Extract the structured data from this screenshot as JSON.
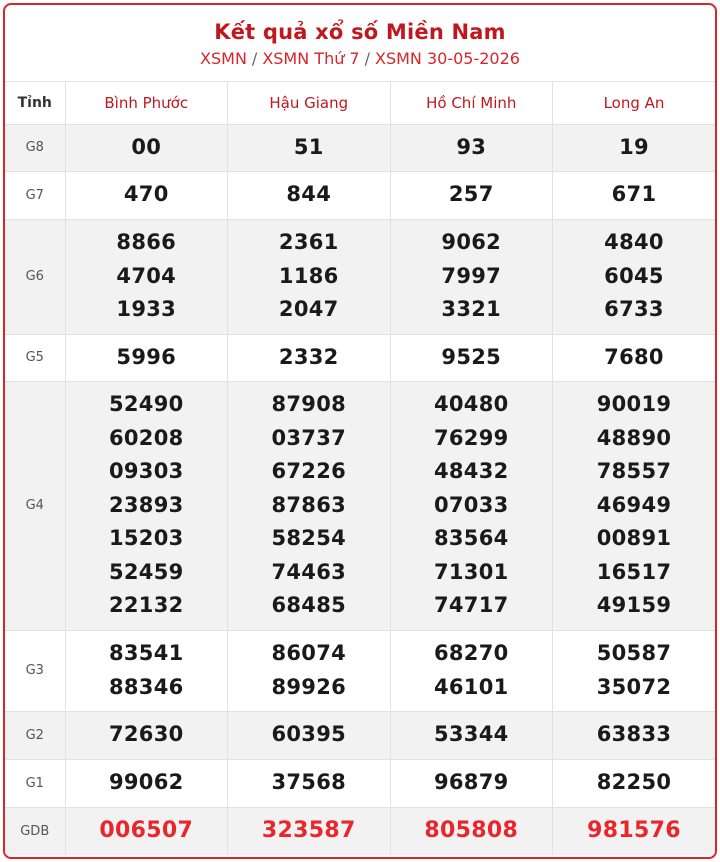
{
  "header": {
    "title": "Kết quả xổ số Miền Nam",
    "breadcrumb": [
      "XSMN",
      "XSMN Thứ 7",
      "XSMN 30-05-2026"
    ]
  },
  "table": {
    "corner_label": "Tỉnh",
    "provinces": [
      "Bình Phước",
      "Hậu Giang",
      "Hồ Chí Minh",
      "Long An"
    ],
    "rows": [
      {
        "label": "G8",
        "values": [
          [
            "00"
          ],
          [
            "51"
          ],
          [
            "93"
          ],
          [
            "19"
          ]
        ]
      },
      {
        "label": "G7",
        "values": [
          [
            "470"
          ],
          [
            "844"
          ],
          [
            "257"
          ],
          [
            "671"
          ]
        ]
      },
      {
        "label": "G6",
        "values": [
          [
            "8866",
            "4704",
            "1933"
          ],
          [
            "2361",
            "1186",
            "2047"
          ],
          [
            "9062",
            "7997",
            "3321"
          ],
          [
            "4840",
            "6045",
            "6733"
          ]
        ]
      },
      {
        "label": "G5",
        "values": [
          [
            "5996"
          ],
          [
            "2332"
          ],
          [
            "9525"
          ],
          [
            "7680"
          ]
        ]
      },
      {
        "label": "G4",
        "values": [
          [
            "52490",
            "60208",
            "09303",
            "23893",
            "15203",
            "52459",
            "22132"
          ],
          [
            "87908",
            "03737",
            "67226",
            "87863",
            "58254",
            "74463",
            "68485"
          ],
          [
            "40480",
            "76299",
            "48432",
            "07033",
            "83564",
            "71301",
            "74717"
          ],
          [
            "90019",
            "48890",
            "78557",
            "46949",
            "00891",
            "16517",
            "49159"
          ]
        ]
      },
      {
        "label": "G3",
        "values": [
          [
            "83541",
            "88346"
          ],
          [
            "86074",
            "89926"
          ],
          [
            "68270",
            "46101"
          ],
          [
            "50587",
            "35072"
          ]
        ]
      },
      {
        "label": "G2",
        "values": [
          [
            "72630"
          ],
          [
            "60395"
          ],
          [
            "53344"
          ],
          [
            "63833"
          ]
        ]
      },
      {
        "label": "G1",
        "values": [
          [
            "99062"
          ],
          [
            "37568"
          ],
          [
            "96879"
          ],
          [
            "82250"
          ]
        ]
      },
      {
        "label": "GDB",
        "values": [
          [
            "006507"
          ],
          [
            "323587"
          ],
          [
            "805808"
          ],
          [
            "981576"
          ]
        ],
        "special": true
      }
    ]
  },
  "colors": {
    "brand_red": "#c0181e",
    "special_red": "#e8262c",
    "row_shade": "#f2f2f2"
  }
}
